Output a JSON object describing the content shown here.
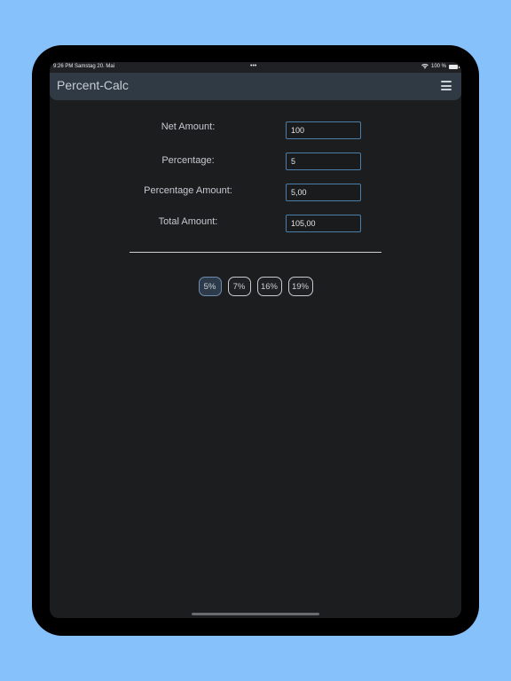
{
  "statusbar": {
    "time_date": "9:26 PM  Samstag 20. Mai",
    "dots": "•••",
    "battery_text": "100 %"
  },
  "navbar": {
    "title": "Percent-Calc",
    "menu_icon": "hamburger-menu-icon"
  },
  "form": {
    "net_amount_label": "Net Amount:",
    "net_amount_value": "100",
    "percentage_label": "Percentage:",
    "percentage_value": "5",
    "percentage_amount_label": "Percentage Amount:",
    "percentage_amount_value": "5,00",
    "total_amount_label": "Total Amount:",
    "total_amount_value": "105,00"
  },
  "presets": [
    {
      "label": "5%",
      "active": true
    },
    {
      "label": "7%",
      "active": false
    },
    {
      "label": "16%",
      "active": false
    },
    {
      "label": "19%",
      "active": false
    }
  ],
  "colors": {
    "background": "#86c1fb",
    "screen": "#1c1d1f",
    "navbar": "#2f3a44",
    "input_border": "#4b7ea8",
    "active_button": "#2d3a4a"
  }
}
